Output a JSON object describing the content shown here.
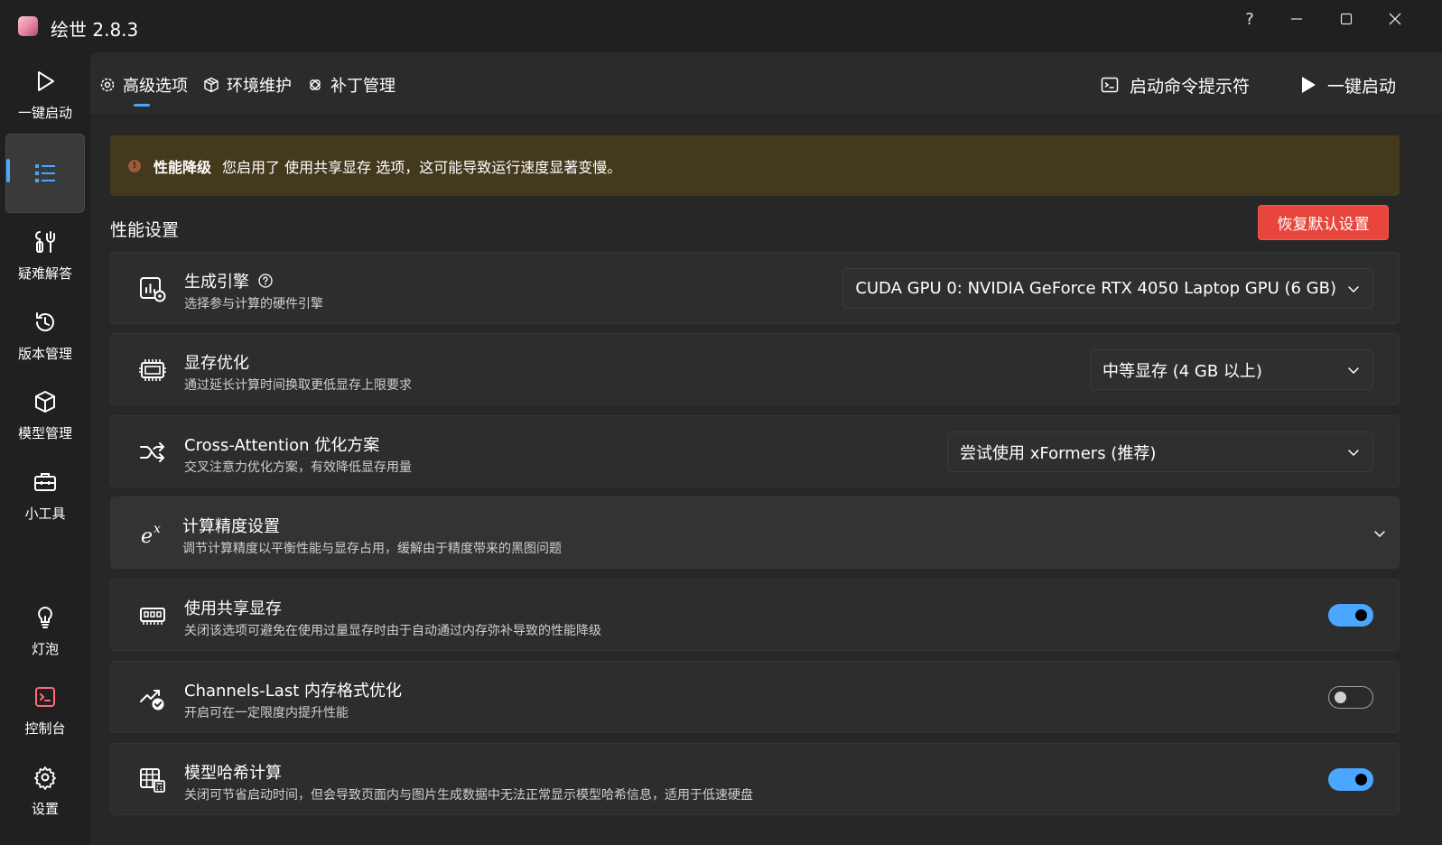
{
  "app": {
    "title": "绘世 2.8.3"
  },
  "window_controls": {
    "help": "?",
    "minimize": "—",
    "maximize": "☐",
    "close": "✕"
  },
  "nav": {
    "items": [
      {
        "label": "一键启动",
        "icon": "play-icon"
      },
      {
        "label": "",
        "icon": "list-icon",
        "active": true
      },
      {
        "label": "疑难解答",
        "icon": "tools-icon"
      },
      {
        "label": "版本管理",
        "icon": "history-icon"
      },
      {
        "label": "模型管理",
        "icon": "cube-icon"
      },
      {
        "label": "小工具",
        "icon": "toolbox-icon"
      },
      {
        "label": "灯泡",
        "icon": "bulb-icon"
      },
      {
        "label": "控制台",
        "icon": "console-icon"
      },
      {
        "label": "设置",
        "icon": "gear-icon"
      }
    ]
  },
  "tabs": [
    {
      "label": "高级选项",
      "icon": "gear-icon",
      "active": true
    },
    {
      "label": "环境维护",
      "icon": "package-icon"
    },
    {
      "label": "补丁管理",
      "icon": "patch-icon"
    }
  ],
  "toolbar": {
    "cmd_label": "启动命令提示符",
    "launch_label": "一键启动"
  },
  "warning": {
    "title": "性能降级",
    "message": "您启用了 使用共享显存 选项，这可能导致运行速度显著变慢。"
  },
  "section": {
    "title": "性能设置",
    "reset_label": "恢复默认设置"
  },
  "settings": [
    {
      "title": "生成引擎",
      "desc": "选择参与计算的硬件引擎",
      "control": "select",
      "value": "CUDA GPU 0: NVIDIA GeForce RTX 4050 Laptop GPU (6 GB)"
    },
    {
      "title": "显存优化",
      "desc": "通过延长计算时间换取更低显存上限要求",
      "control": "select",
      "value": "中等显存 (4 GB 以上)"
    },
    {
      "title": "Cross-Attention 优化方案",
      "desc": "交叉注意力优化方案，有效降低显存用量",
      "control": "select",
      "value": "尝试使用 xFormers (推荐)"
    },
    {
      "title": "计算精度设置",
      "desc": "调节计算精度以平衡性能与显存占用，缓解由于精度带来的黑图问题",
      "control": "expander"
    },
    {
      "title": "使用共享显存",
      "desc": "关闭该选项可避免在使用过量显存时由于自动通过内存弥补导致的性能降级",
      "control": "toggle",
      "checked": true
    },
    {
      "title": "Channels-Last 内存格式优化",
      "desc": "开启可在一定限度内提升性能",
      "control": "toggle",
      "checked": false
    },
    {
      "title": "模型哈希计算",
      "desc": "关闭可节省启动时间，但会导致页面内与图片生成数据中无法正常显示模型哈希信息，适用于低速硬盘",
      "control": "toggle",
      "checked": true
    }
  ],
  "colors": {
    "accent": "#4aa7ff",
    "danger": "#e8453c",
    "warning_bg": "#43391c"
  }
}
